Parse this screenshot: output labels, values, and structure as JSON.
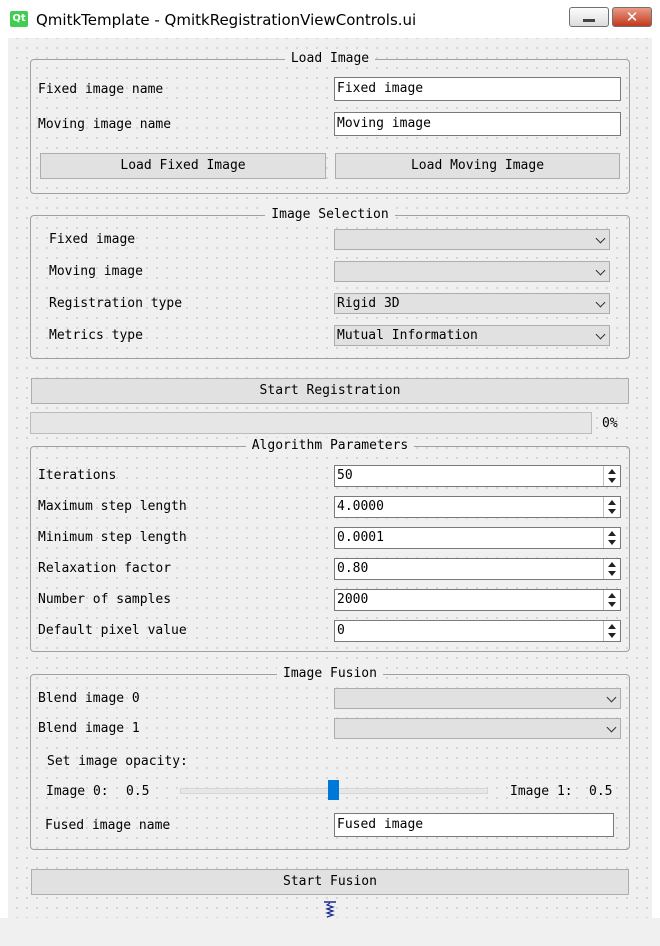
{
  "window": {
    "title": "QmitkTemplate - QmitkRegistrationViewControls.ui",
    "logo_text": "Qt"
  },
  "load_image": {
    "title": "Load Image",
    "fixed_label": "Fixed image name",
    "fixed_value": "Fixed image",
    "moving_label": "Moving image name",
    "moving_value": "Moving image",
    "load_fixed_button": "Load Fixed Image",
    "load_moving_button": "Load Moving Image"
  },
  "image_selection": {
    "title": "Image Selection",
    "fixed_label": "Fixed image",
    "fixed_value": "",
    "moving_label": "Moving image",
    "moving_value": "",
    "reg_type_label": "Registration type",
    "reg_type_value": "Rigid 3D",
    "metrics_label": "Metrics type",
    "metrics_value": "Mutual Information"
  },
  "registration": {
    "start_button": "Start Registration",
    "progress_text": "0%",
    "progress_fraction": 0
  },
  "algorithm": {
    "title": "Algorithm Parameters",
    "params": [
      {
        "label": "Iterations",
        "value": "50"
      },
      {
        "label": "Maximum step length",
        "value": "4.0000"
      },
      {
        "label": "Minimum step length",
        "value": "0.0001"
      },
      {
        "label": "Relaxation factor",
        "value": "0.80"
      },
      {
        "label": "Number of samples",
        "value": "2000"
      },
      {
        "label": "Default pixel value",
        "value": "0"
      }
    ]
  },
  "fusion": {
    "title": "Image Fusion",
    "blend0_label": "Blend image 0",
    "blend0_value": "",
    "blend1_label": "Blend image 1",
    "blend1_value": "",
    "opacity_label": "Set image opacity:",
    "image0_label": "Image 0:",
    "image0_value": "0.5",
    "image1_label": "Image 1:",
    "image1_value": "0.5",
    "slider_fraction": 0.5,
    "fused_label": "Fused image name",
    "fused_value": "Fused image",
    "start_button": "Start Fusion"
  },
  "colors": {
    "accent": "#0078d7",
    "qt_green": "#41cd52",
    "close_red": "#c23a1c"
  }
}
